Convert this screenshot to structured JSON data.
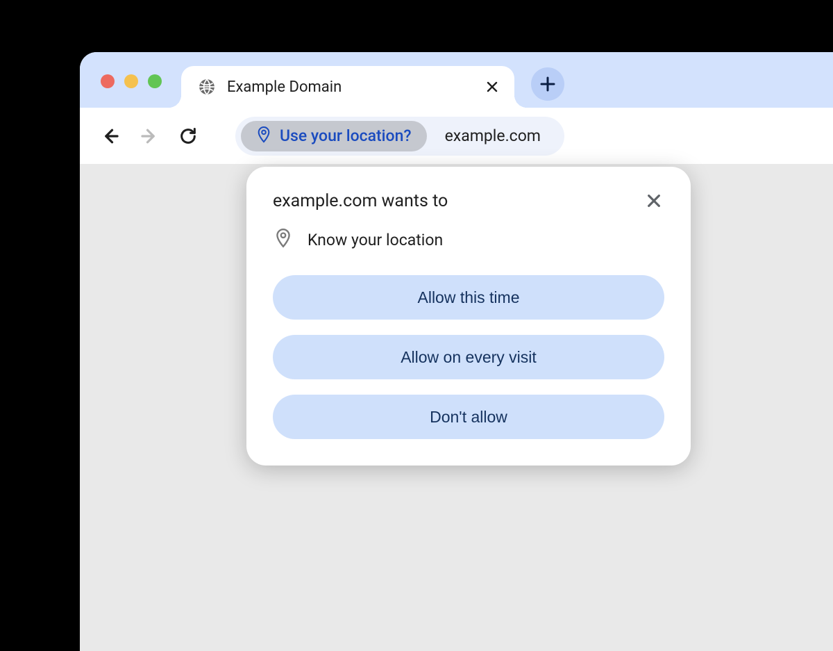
{
  "tab": {
    "title": "Example Domain"
  },
  "addressbar": {
    "permission_chip": "Use your location?",
    "url": "example.com"
  },
  "popover": {
    "title": "example.com wants to",
    "detail": "Know your location",
    "allow_once": "Allow this time",
    "allow_always": "Allow on every visit",
    "deny": "Don't allow"
  }
}
